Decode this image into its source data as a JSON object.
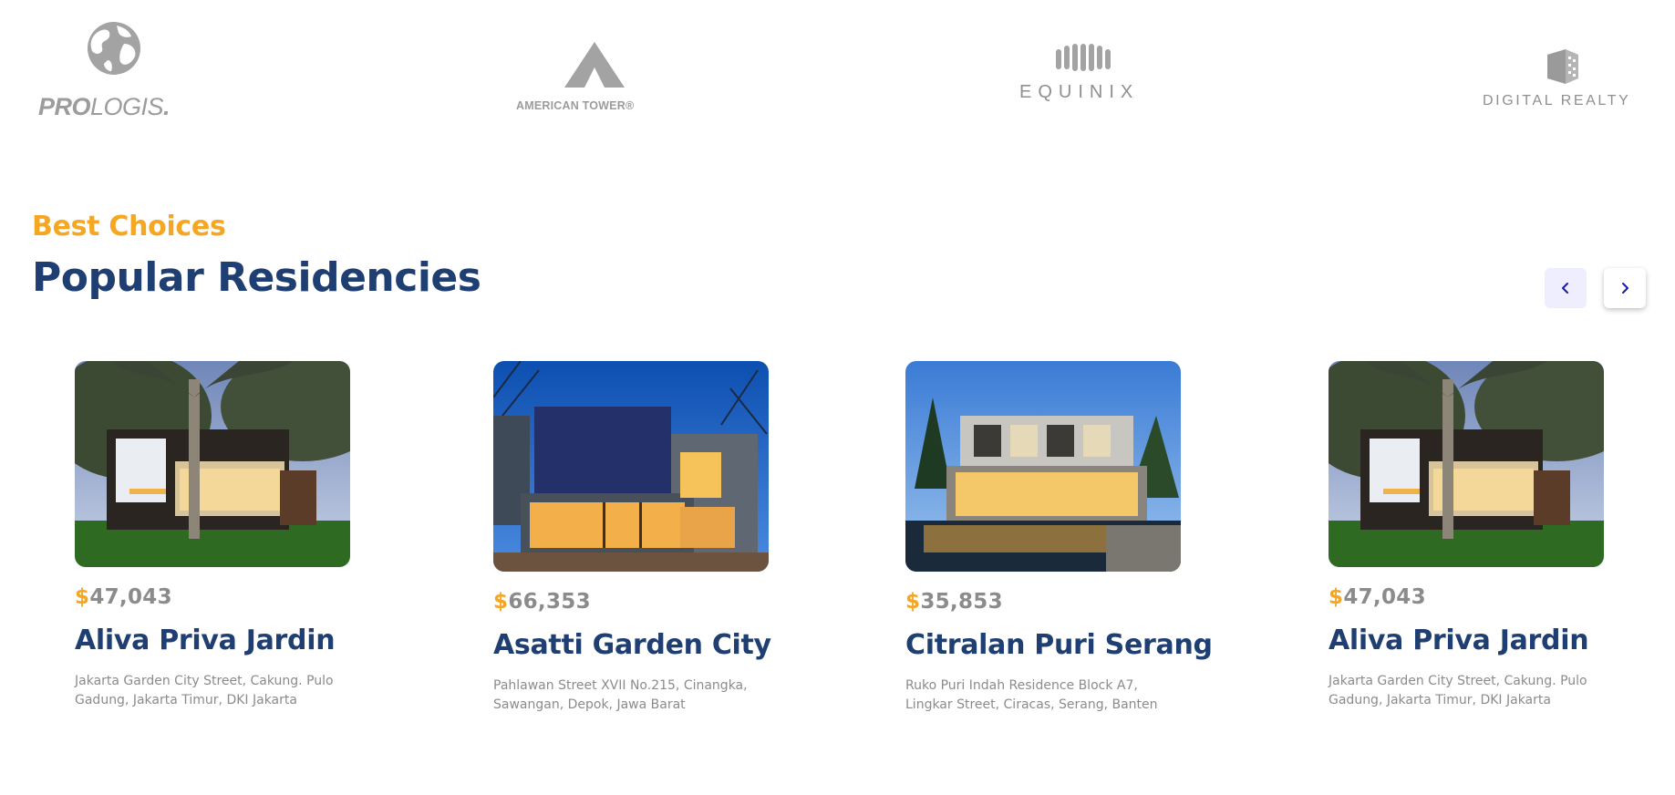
{
  "logos": {
    "prologis": {
      "bold": "PRO",
      "light": "LOGIS",
      "mark": "."
    },
    "american_tower": {
      "text": "AMERICAN TOWER",
      "mark": "®"
    },
    "equinix": {
      "text": "EQUINIX"
    },
    "digital_realty": {
      "text": "DIGITAL REALTY"
    }
  },
  "section": {
    "eyebrow": "Best Choices",
    "title": "Popular Residencies",
    "prev_icon": "chevron-left-icon",
    "next_icon": "chevron-right-icon"
  },
  "colors": {
    "accent": "#f5a623",
    "heading": "#1f3e72",
    "muted": "#8c8b8b",
    "prev_button_bg": "#eeeeff"
  },
  "residencies": [
    {
      "currency": "$",
      "price": "47,043",
      "name": "Aliva Priva Jardin",
      "address": "Jakarta Garden City Street, Cakung. Pulo Gadung, Jakarta Timur, DKI Jakarta"
    },
    {
      "currency": "$",
      "price": "66,353",
      "name": "Asatti Garden City",
      "address": "Pahlawan Street XVII No.215, Cinangka, Sawangan, Depok, Jawa Barat"
    },
    {
      "currency": "$",
      "price": "35,853",
      "name": "Citralan Puri Serang",
      "address": "Ruko Puri Indah Residence Block A7, Lingkar Street, Ciracas, Serang, Banten"
    },
    {
      "currency": "$",
      "price": "47,043",
      "name": "Aliva Priva Jardin",
      "address": "Jakarta Garden City Street, Cakung. Pulo Gadung, Jakarta Timur, DKI Jakarta"
    }
  ]
}
